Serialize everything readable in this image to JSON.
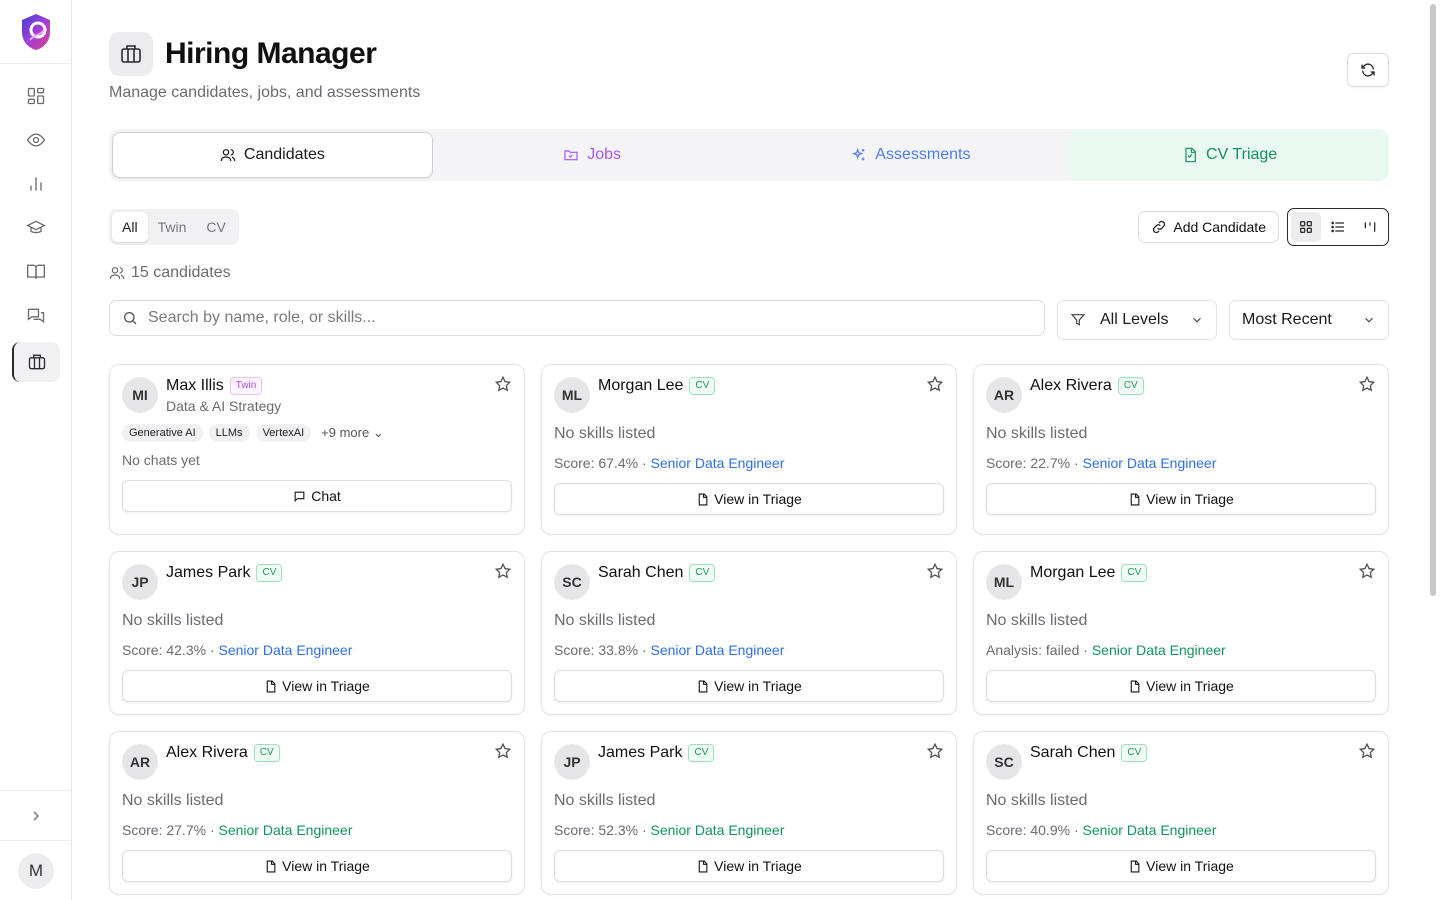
{
  "header": {
    "title": "Hiring Manager",
    "subtitle": "Manage candidates, jobs, and assessments"
  },
  "tabs": [
    {
      "label": "Candidates",
      "icon": "users-icon",
      "active": true
    },
    {
      "label": "Jobs",
      "icon": "folder-icon",
      "color": "#a855f7"
    },
    {
      "label": "Assessments",
      "icon": "sparkles-icon",
      "color": "#4f7cf0"
    },
    {
      "label": "CV Triage",
      "icon": "file-icon",
      "color": "#15915f"
    }
  ],
  "filter_segment": {
    "items": [
      "All",
      "Twin",
      "CV"
    ],
    "selected": "All"
  },
  "toolbar": {
    "add_label": "Add Candidate",
    "view_modes": [
      "grid",
      "list",
      "kanban"
    ],
    "active_view": "grid"
  },
  "count_text": "15 candidates",
  "search": {
    "placeholder": "Search by name, role, or skills...",
    "value": ""
  },
  "level_select": {
    "value": "All Levels"
  },
  "sort_select": {
    "value": "Most Recent"
  },
  "cards": [
    {
      "initials": "MI",
      "name": "Max Illis",
      "badge": "Twin",
      "role": "Data & AI Strategy",
      "tags": [
        "Generative AI",
        "LLMs",
        "VertexAI"
      ],
      "more": "+9 more",
      "status": "No chats yet",
      "action": "Chat"
    },
    {
      "initials": "ML",
      "name": "Morgan Lee",
      "badge": "CV",
      "skills": "No skills listed",
      "score": "Score: 67.4% · ",
      "job": "Senior Data Engineer",
      "job_color": "blue",
      "action": "View in Triage"
    },
    {
      "initials": "AR",
      "name": "Alex Rivera",
      "badge": "CV",
      "skills": "No skills listed",
      "score": "Score: 22.7% · ",
      "job": "Senior Data Engineer",
      "job_color": "blue",
      "action": "View in Triage"
    },
    {
      "initials": "JP",
      "name": "James Park",
      "badge": "CV",
      "skills": "No skills listed",
      "score": "Score: 42.3% · ",
      "job": "Senior Data Engineer",
      "job_color": "blue",
      "action": "View in Triage"
    },
    {
      "initials": "SC",
      "name": "Sarah Chen",
      "badge": "CV",
      "skills": "No skills listed",
      "score": "Score: 33.8% · ",
      "job": "Senior Data Engineer",
      "job_color": "blue",
      "action": "View in Triage"
    },
    {
      "initials": "ML",
      "name": "Morgan Lee",
      "badge": "CV",
      "skills": "No skills listed",
      "score": "Analysis: failed · ",
      "job": "Senior Data Engineer",
      "job_color": "green",
      "action": "View in Triage"
    },
    {
      "initials": "AR",
      "name": "Alex Rivera",
      "badge": "CV",
      "skills": "No skills listed",
      "score": "Score: 27.7% · ",
      "job": "Senior Data Engineer",
      "job_color": "green",
      "action": "View in Triage"
    },
    {
      "initials": "JP",
      "name": "James Park",
      "badge": "CV",
      "skills": "No skills listed",
      "score": "Score: 52.3% · ",
      "job": "Senior Data Engineer",
      "job_color": "green",
      "action": "View in Triage"
    },
    {
      "initials": "SC",
      "name": "Sarah Chen",
      "badge": "CV",
      "skills": "No skills listed",
      "score": "Score: 40.9% · ",
      "job": "Senior Data Engineer",
      "job_color": "green",
      "action": "View in Triage"
    }
  ],
  "sidebar": {
    "items": [
      "dashboard-icon",
      "eye-icon",
      "bar-chart-icon",
      "graduation-cap-icon",
      "book-icon",
      "messages-icon",
      "briefcase-icon"
    ],
    "active": "briefcase-icon",
    "user_initial": "M"
  },
  "colors": {
    "accent_green": "#15915f",
    "accent_blue": "#2f6fe0",
    "accent_purple": "#a855f7"
  }
}
